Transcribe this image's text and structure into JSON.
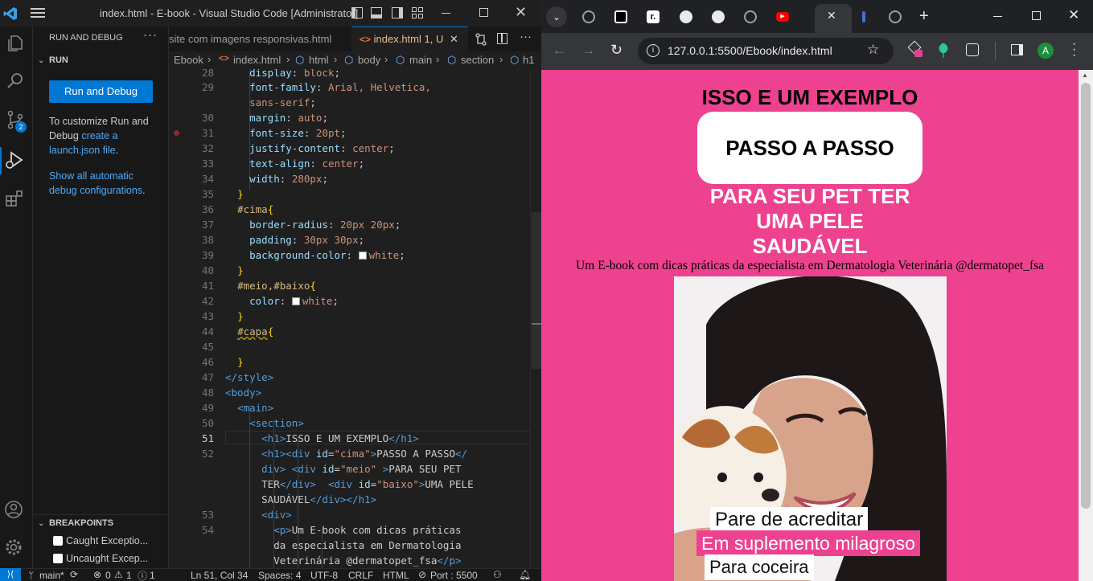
{
  "vscode": {
    "title": "index.html - E-book - Visual Studio Code [Administrator]",
    "sidebar": {
      "header": "RUN AND DEBUG",
      "section": "RUN",
      "run_button": "Run and Debug",
      "help_pre": "To customize Run and Debug ",
      "help_link": "create a launch.json file",
      "help_post": ".",
      "auto_link": "Show all automatic debug configurations",
      "auto_post": ".",
      "breakpoints_header": "BREAKPOINTS",
      "bp_caught": "Caught Exceptio...",
      "bp_uncaught": "Uncaught Excep..."
    },
    "scm_badge": "2",
    "tabs": {
      "inactive": "site com imagens responsivas.html",
      "active": "index.html 1, U"
    },
    "breadcrumb": [
      "Ebook",
      "index.html",
      "html",
      "body",
      "main",
      "section",
      "h1"
    ],
    "status": {
      "branch": "main*",
      "errors": "0",
      "warnings": "1",
      "info": "1",
      "position": "Ln 51, Col 34",
      "spaces": "Spaces: 4",
      "encoding": "UTF-8",
      "eol": "CRLF",
      "language": "HTML",
      "port": "Port : 5500"
    },
    "gutter": {
      "l28": "28",
      "l29": "29",
      "l30": "30",
      "l31": "31",
      "l32": "32",
      "l33": "33",
      "l34": "34",
      "l35": "35",
      "l36": "36",
      "l37": "37",
      "l38": "38",
      "l39": "39",
      "l40": "40",
      "l41": "41",
      "l42": "42",
      "l43": "43",
      "l44": "44",
      "l45": "45",
      "l46": "46",
      "l47": "47",
      "l48": "48",
      "l49": "49",
      "l50": "50",
      "l51": "51",
      "l52": "52",
      "l53": "53",
      "l54": "54"
    },
    "code": {
      "l28_prop": "display",
      "l28_val": "block",
      "l29_prop": "font-family",
      "l29_val": "Arial, Helvetica,",
      "l29b_val": "sans-serif",
      "l30_prop": "margin",
      "l30_val": "auto",
      "l31_prop": "font-size",
      "l31_val": "20pt",
      "l32_prop": "justify-content",
      "l32_val": "center",
      "l33_prop": "text-align",
      "l33_val": "center",
      "l34_prop": "width",
      "l34_val": "280px",
      "l35_close": "}",
      "l36_sel": "#cima",
      "l36_open": "{",
      "l37_prop": "border-radius",
      "l37_val": "20px 20px",
      "l38_prop": "padding",
      "l38_val": "30px 30px",
      "l39_prop": "background-color",
      "l39_val": "white",
      "l40_close": "}",
      "l41_sel": "#meio,#baixo",
      "l41_open": "{",
      "l42_prop": "color",
      "l42_val": "white",
      "l43_close": "}",
      "l44_sel": "#capa",
      "l44_open": "{",
      "l46_close": "}",
      "l47": "</style>",
      "l48": "<body>",
      "l49": "<main>",
      "l50": "<section>",
      "l51_txt": "ISSO E UM EXEMPLO",
      "l52_a_txt": "PASSO A PASSO",
      "l52_b_txt": "PARA SEU PET",
      "l52_c_a": "TER",
      "l52_c_txt": "UMA PELE",
      "l52_d_txt": "SAUDÁVEL",
      "l53": "<div>",
      "l54_a": "Um E-book com dicas práticas",
      "l54_b": "da especialista em Dermatologia",
      "l54_c": "Veterinária @dermatopet_fsa"
    }
  },
  "browser": {
    "url": "127.0.0.1:5500/Ebook/index.html",
    "profile_initial": "A"
  },
  "webpage": {
    "h1": "ISSO E UM EXEMPLO",
    "cima": "PASSO A PASSO",
    "meio": "PARA SEU PET TER",
    "baixo": "UMA PELE SAUDÁVEL",
    "description": "Um E-book com dicas práticas da especialista em Dermatologia Veterinária @dermatopet_fsa",
    "img_line1": "Pare de acreditar",
    "img_line2": "Em suplemento milagroso",
    "img_line3": "Para coceira"
  },
  "colors": {
    "page_bg": "#ee4290",
    "accent_blue": "#0078d4",
    "caption_pink": "#ee4290"
  }
}
